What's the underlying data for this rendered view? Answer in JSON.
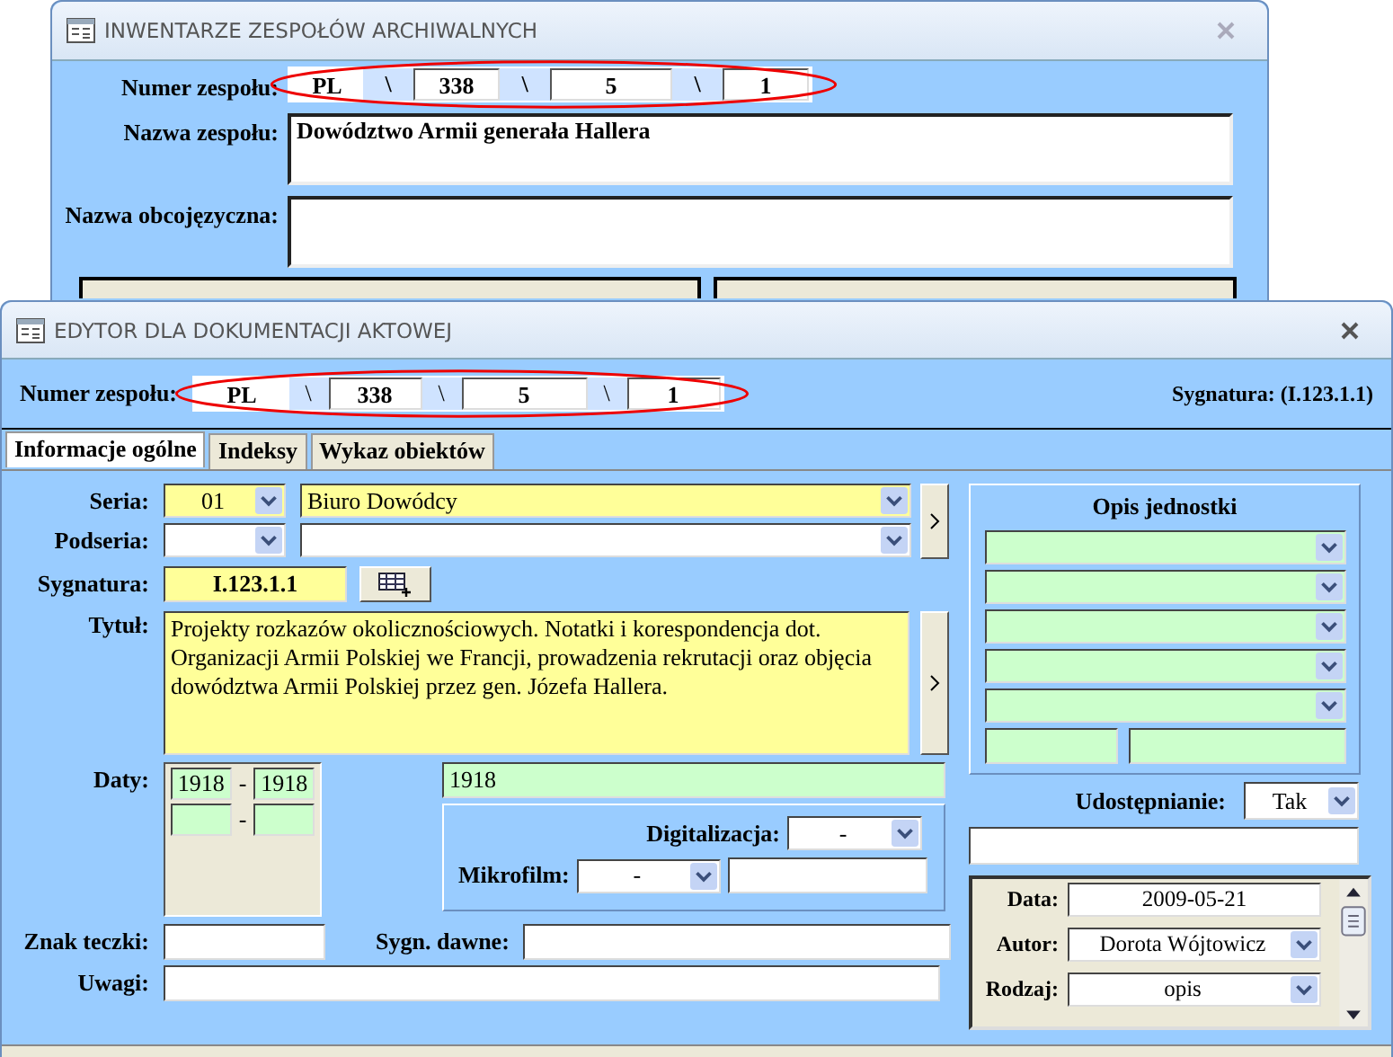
{
  "inventory_window": {
    "title": "INWENTARZE ZESPOŁÓW ARCHIWALNYCH",
    "number_label": "Numer zespołu:",
    "number_parts": [
      "PL",
      "\\",
      "338",
      "\\",
      "5",
      "\\",
      "1"
    ],
    "name_label": "Nazwa zespołu:",
    "name_value": "Dowództwo Armii generała Hallera",
    "foreign_label": "Nazwa obcojęzyczna:"
  },
  "editor_window": {
    "title": "EDYTOR DLA DOKUMENTACJI AKTOWEJ",
    "number_label": "Numer zespołu:",
    "number_parts": [
      "PL",
      "\\",
      "338",
      "\\",
      "5",
      "\\",
      "1"
    ],
    "signature_caption": "Sygnatura: (I.123.1.1)",
    "tabs": [
      {
        "label": "Informacje ogólne",
        "selected": true
      },
      {
        "label": "Indeksy",
        "selected": false
      },
      {
        "label": "Wykaz obiektów",
        "selected": false
      }
    ],
    "series": {
      "label": "Seria:",
      "code": "01",
      "name": "Biuro Dowódcy"
    },
    "subseries": {
      "label": "Podseria:"
    },
    "signature": {
      "label": "Sygnatura:",
      "value": "I.123.1.1"
    },
    "title_field": {
      "label": "Tytuł:",
      "value": "Projekty rozkazów okolicznościowych. Notatki i korespondencja dot. Organizacji Armii Polskiej we Francji, prowadzenia rekrutacji oraz objęcia dowództwa Armii Polskiej przez gen. Józefa Hallera."
    },
    "dates": {
      "label": "Daty:",
      "ranges": [
        {
          "from": "1918",
          "sep": "-",
          "to": "1918"
        },
        {
          "sep": "-"
        }
      ],
      "text": "1918"
    },
    "digitization": {
      "label": "Digitalizacja:",
      "value": "-"
    },
    "microfilm": {
      "label": "Mikrofilm:",
      "value": "-"
    },
    "folder_mark": {
      "label": "Znak teczki:"
    },
    "old_signature": {
      "label": "Sygn. dawne:"
    },
    "notes": {
      "label": "Uwagi:"
    },
    "unit_description": {
      "title": "Opis jednostki"
    },
    "access": {
      "label": "Udostępnianie:",
      "value": "Tak"
    },
    "history": [
      {
        "kind": "text",
        "label": "Data:",
        "value": "2009-05-21"
      },
      {
        "kind": "dropdown",
        "label": "Autor:",
        "value": "Dorota Wójtowicz"
      },
      {
        "kind": "dropdown",
        "label": "Rodzaj:",
        "value": "opis"
      }
    ]
  }
}
